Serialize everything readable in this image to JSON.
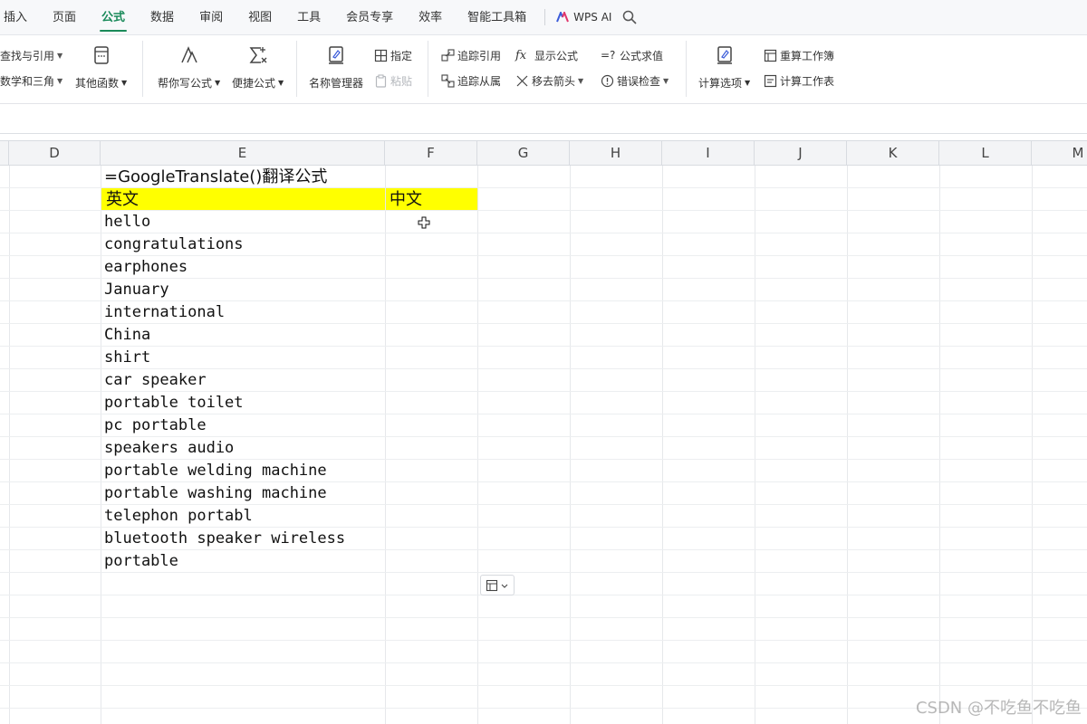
{
  "menu": {
    "tabs": [
      "插入",
      "页面",
      "公式",
      "数据",
      "审阅",
      "视图",
      "工具",
      "会员专享",
      "效率",
      "智能工具箱"
    ],
    "active": "公式",
    "wps_ai": "WPS AI"
  },
  "ribbon": {
    "lookup": "查找与引用",
    "math": "数学和三角",
    "other_funcs": "其他函数",
    "help_write": "帮你写公式",
    "quick_formula": "便捷公式",
    "name_manager": "名称管理器",
    "specify": "指定",
    "paste": "粘贴",
    "trace_precedents": "追踪引用",
    "trace_dependents": "追踪从属",
    "show_formulas": "显示公式",
    "remove_arrows": "移去箭头",
    "evaluate": "公式求值",
    "error_check": "错误检查",
    "calc_options": "计算选项",
    "recalc_workbook": "重算工作簿",
    "calc_sheet": "计算工作表"
  },
  "columns": [
    "D",
    "E",
    "F",
    "G",
    "H",
    "I",
    "J",
    "K",
    "L",
    "M"
  ],
  "sheet": {
    "title": "=GoogleTranslate()翻译公式",
    "header_en": "英文",
    "header_zh": "中文",
    "rows": [
      "hello",
      "congratulations",
      "earphones",
      "January",
      "international",
      "China",
      "shirt",
      "car speaker",
      "portable toilet",
      "pc portable",
      "speakers audio",
      "portable welding machine",
      "portable washing machine",
      "telephon portabl",
      "bluetooth speaker wireless",
      "portable"
    ]
  },
  "watermark": "CSDN @不吃鱼不吃鱼",
  "colors": {
    "accent": "#1a8a5a",
    "highlight": "#ffff00"
  }
}
